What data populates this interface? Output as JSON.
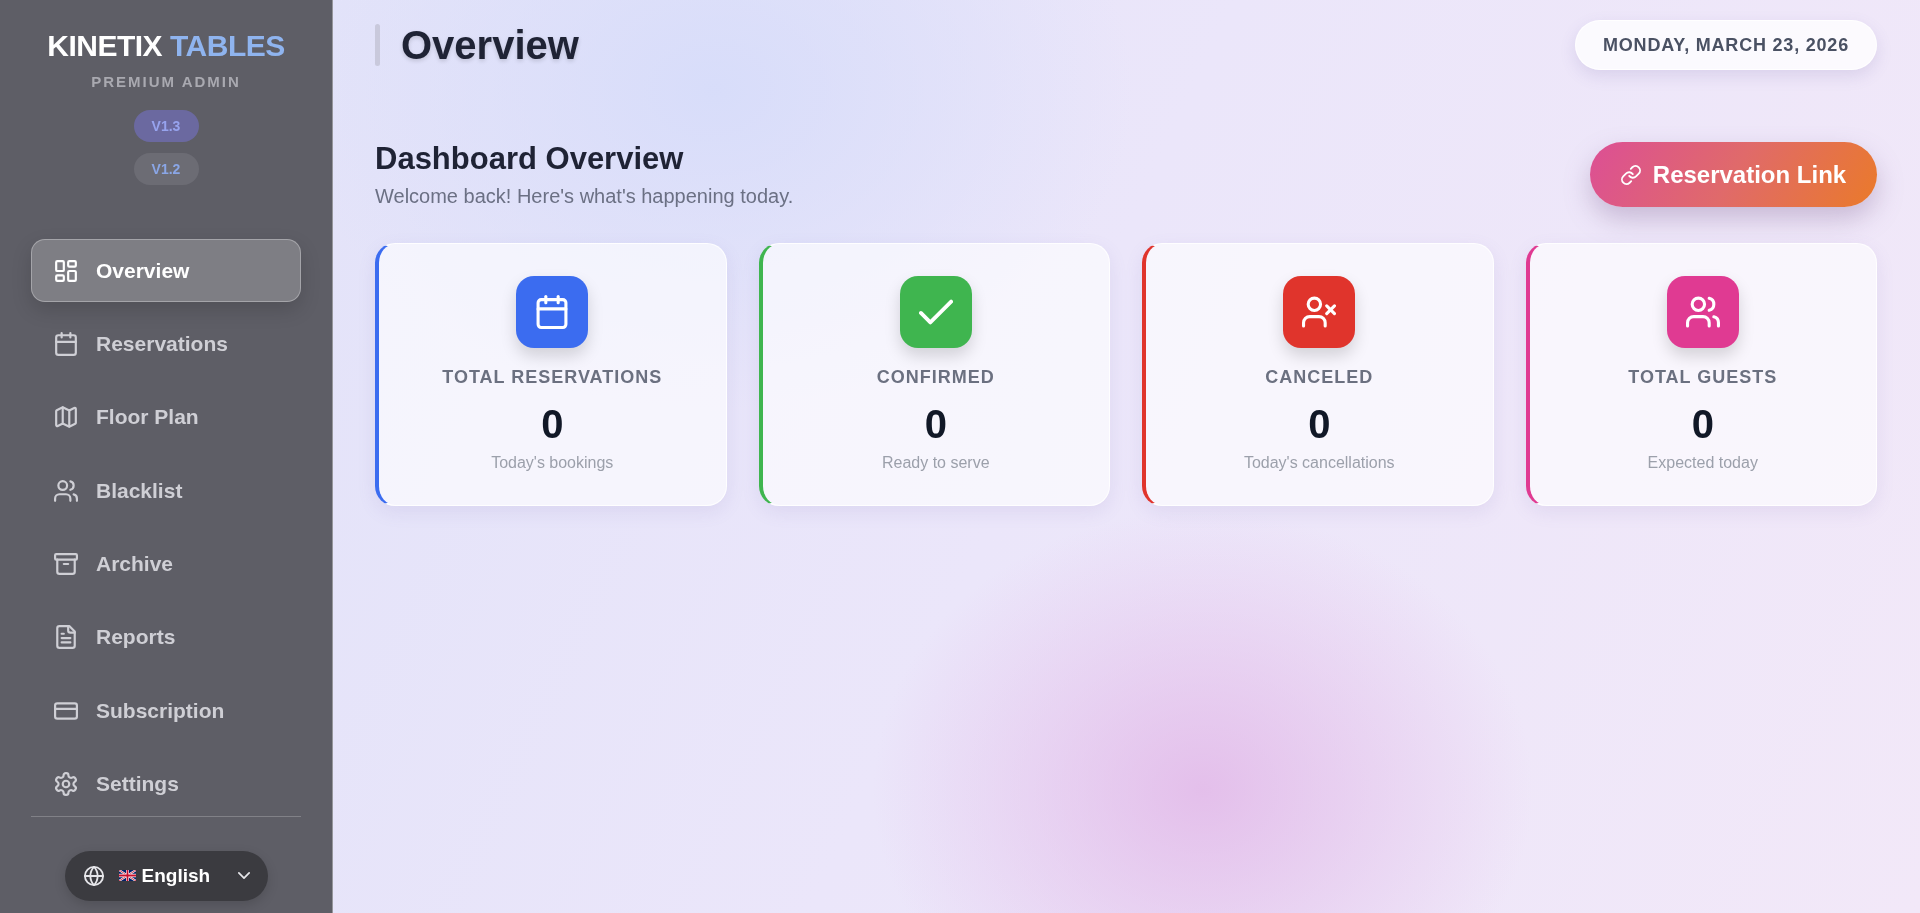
{
  "sidebar": {
    "brand": {
      "name": "KINETIX",
      "accent": "TABLES",
      "subtitle": "PREMIUM ADMIN"
    },
    "versions": [
      {
        "label": "V1.3",
        "selected": true
      },
      {
        "label": "V1.2",
        "selected": false
      }
    ],
    "nav": [
      {
        "label": "Overview",
        "selected": true
      },
      {
        "label": "Reservations",
        "selected": false
      },
      {
        "label": "Floor Plan",
        "selected": false
      },
      {
        "label": "Blacklist",
        "selected": false
      },
      {
        "label": "Archive",
        "selected": false
      },
      {
        "label": "Reports",
        "selected": false
      },
      {
        "label": "Subscription",
        "selected": false
      },
      {
        "label": "Settings",
        "selected": false
      }
    ],
    "language": {
      "label": "English"
    }
  },
  "header": {
    "title": "Overview",
    "date": "MONDAY, MARCH 23, 2026"
  },
  "dashboard": {
    "title": "Dashboard Overview",
    "subtitle": "Welcome back! Here's what's happening today.",
    "action": "Reservation Link"
  },
  "stats": [
    {
      "label": "TOTAL RESERVATIONS",
      "value": "0",
      "caption": "Today's bookings",
      "color": "#3b6cf0"
    },
    {
      "label": "CONFIRMED",
      "value": "0",
      "caption": "Ready to serve",
      "color": "#3fb54f"
    },
    {
      "label": "CANCELED",
      "value": "0",
      "caption": "Today's cancellations",
      "color": "#e0342c"
    },
    {
      "label": "TOTAL GUESTS",
      "value": "0",
      "caption": "Expected today",
      "color": "#e03a92"
    }
  ]
}
